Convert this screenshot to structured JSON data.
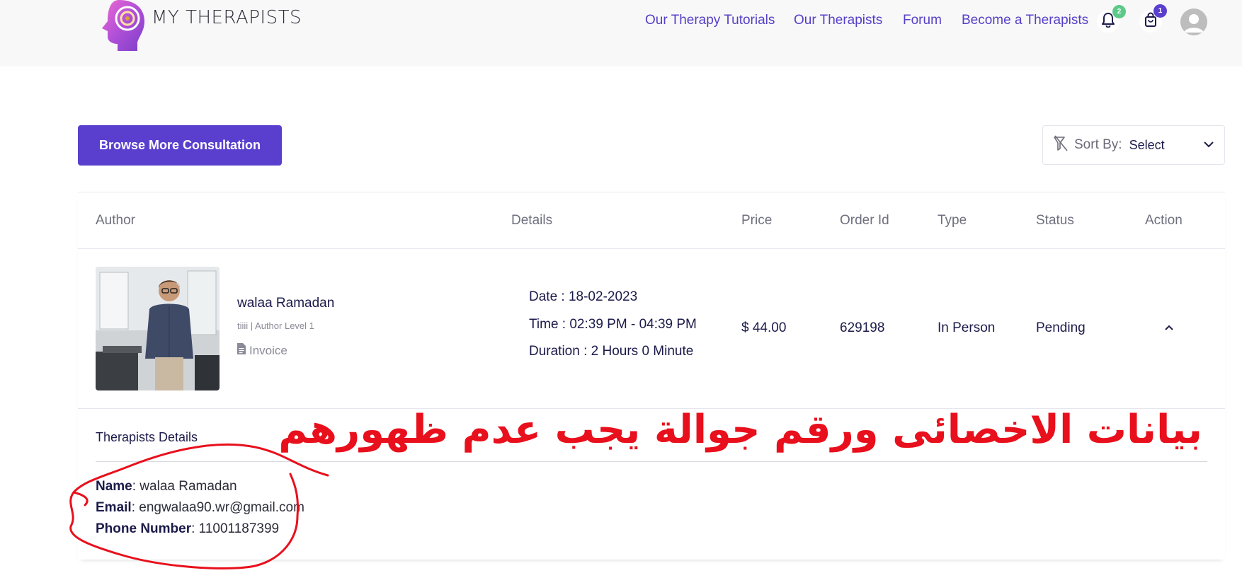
{
  "header": {
    "logo_text": "MY THERAPISTS",
    "nav": [
      {
        "label": "Our Therapy Tutorials"
      },
      {
        "label": "Our Therapists"
      },
      {
        "label": "Forum"
      },
      {
        "label": "Become a Therapists"
      }
    ],
    "notifications_count": "2",
    "cart_count": "1",
    "icons": {
      "notifications": "bell-icon",
      "cart": "shopping-bag-icon",
      "user": "user-avatar-icon"
    }
  },
  "toolbar": {
    "browse_label": "Browse More Consultation",
    "sort_label": "Sort By:",
    "sort_value": "Select"
  },
  "table": {
    "columns": [
      "Author",
      "Details",
      "Price",
      "Order Id",
      "Type",
      "Status",
      "Action"
    ],
    "row": {
      "author_name": "walaa Ramadan",
      "author_level": "tiiii | Author Level 1",
      "invoice_label": "Invoice",
      "date": "Date : 18-02-2023",
      "time": "Time : 02:39 PM - 04:39 PM",
      "duration": "Duration : 2 Hours 0 Minute",
      "price": "$ 44.00",
      "order_id": "629198",
      "type": "In Person",
      "status": "Pending"
    }
  },
  "therapist_details": {
    "title": "Therapists Details",
    "name_label": "Name",
    "name_value": ": walaa Ramadan",
    "email_label": "Email",
    "email_value": ": engwalaa90.wr@gmail.com",
    "phone_label": "Phone Number",
    "phone_value": ": 11001187399"
  },
  "annotation": {
    "text": "بيانات الاخصائى ورقم جوالة يجب عدم ظهورهم",
    "color": "#e8101c"
  },
  "colors": {
    "brand": "#5a3fcf",
    "nav_link": "#5540c8",
    "badge_green": "#5cc98a",
    "badge_purple": "#5a3fcf"
  }
}
